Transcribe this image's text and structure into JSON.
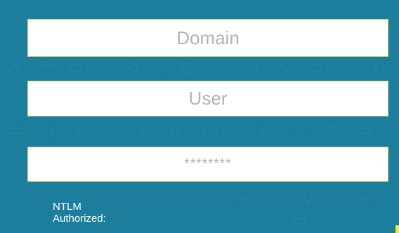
{
  "form": {
    "domain": {
      "placeholder": "Domain"
    },
    "user": {
      "placeholder": "User"
    },
    "password": {
      "placeholder": "********"
    }
  },
  "status": {
    "ntlm_label": "NTLM",
    "authorized_label": "Authorized:"
  },
  "colors": {
    "background": "#1d7d9c",
    "field_border": "#c9cf64",
    "placeholder_text": "#b3b3b3",
    "label_text": "#ffffff",
    "corner_accent": "#f2e73a"
  }
}
